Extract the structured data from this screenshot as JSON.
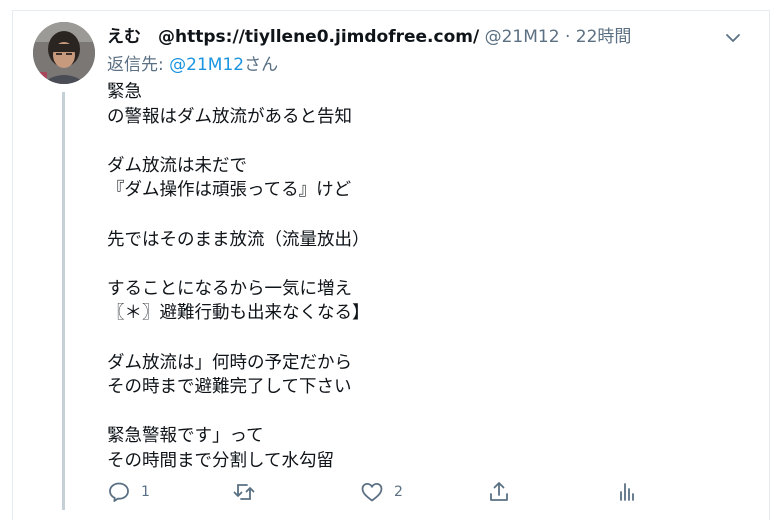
{
  "tweet": {
    "author_name": "えむ　@https://tiyllene0.jimdofree.com/",
    "handle": "@21M12",
    "separator": "·",
    "time": "22時間",
    "reply_prefix": "返信先: ",
    "reply_mention": "@21M12",
    "reply_suffix": "さん",
    "body_lines": [
      "緊急",
      "の警報はダム放流があると告知",
      "",
      "ダム放流は未だで",
      "『ダム操作は頑張ってる』けど",
      "",
      "先ではそのまま放流（流量放出）",
      "",
      "することになるから一気に増え",
      "〖＊〗避難行動も出来なくなる】",
      "",
      "ダム放流は」何時の予定だから",
      "その時まで避難完了して下さい",
      "",
      "緊急警報です」って",
      "その時間まで分割して水勾留"
    ]
  },
  "actions": {
    "reply_icon": "reply-icon",
    "reply_count": "1",
    "retweet_icon": "retweet-icon",
    "retweet_count": "",
    "like_icon": "heart-icon",
    "like_count": "2",
    "share_icon": "share-icon",
    "analytics_icon": "analytics-icon"
  },
  "colors": {
    "text_primary": "#0f1419",
    "text_secondary": "#5b7083",
    "link": "#1b95e0",
    "thread_line": "#c4cfd6",
    "border": "#e6ecf0"
  }
}
